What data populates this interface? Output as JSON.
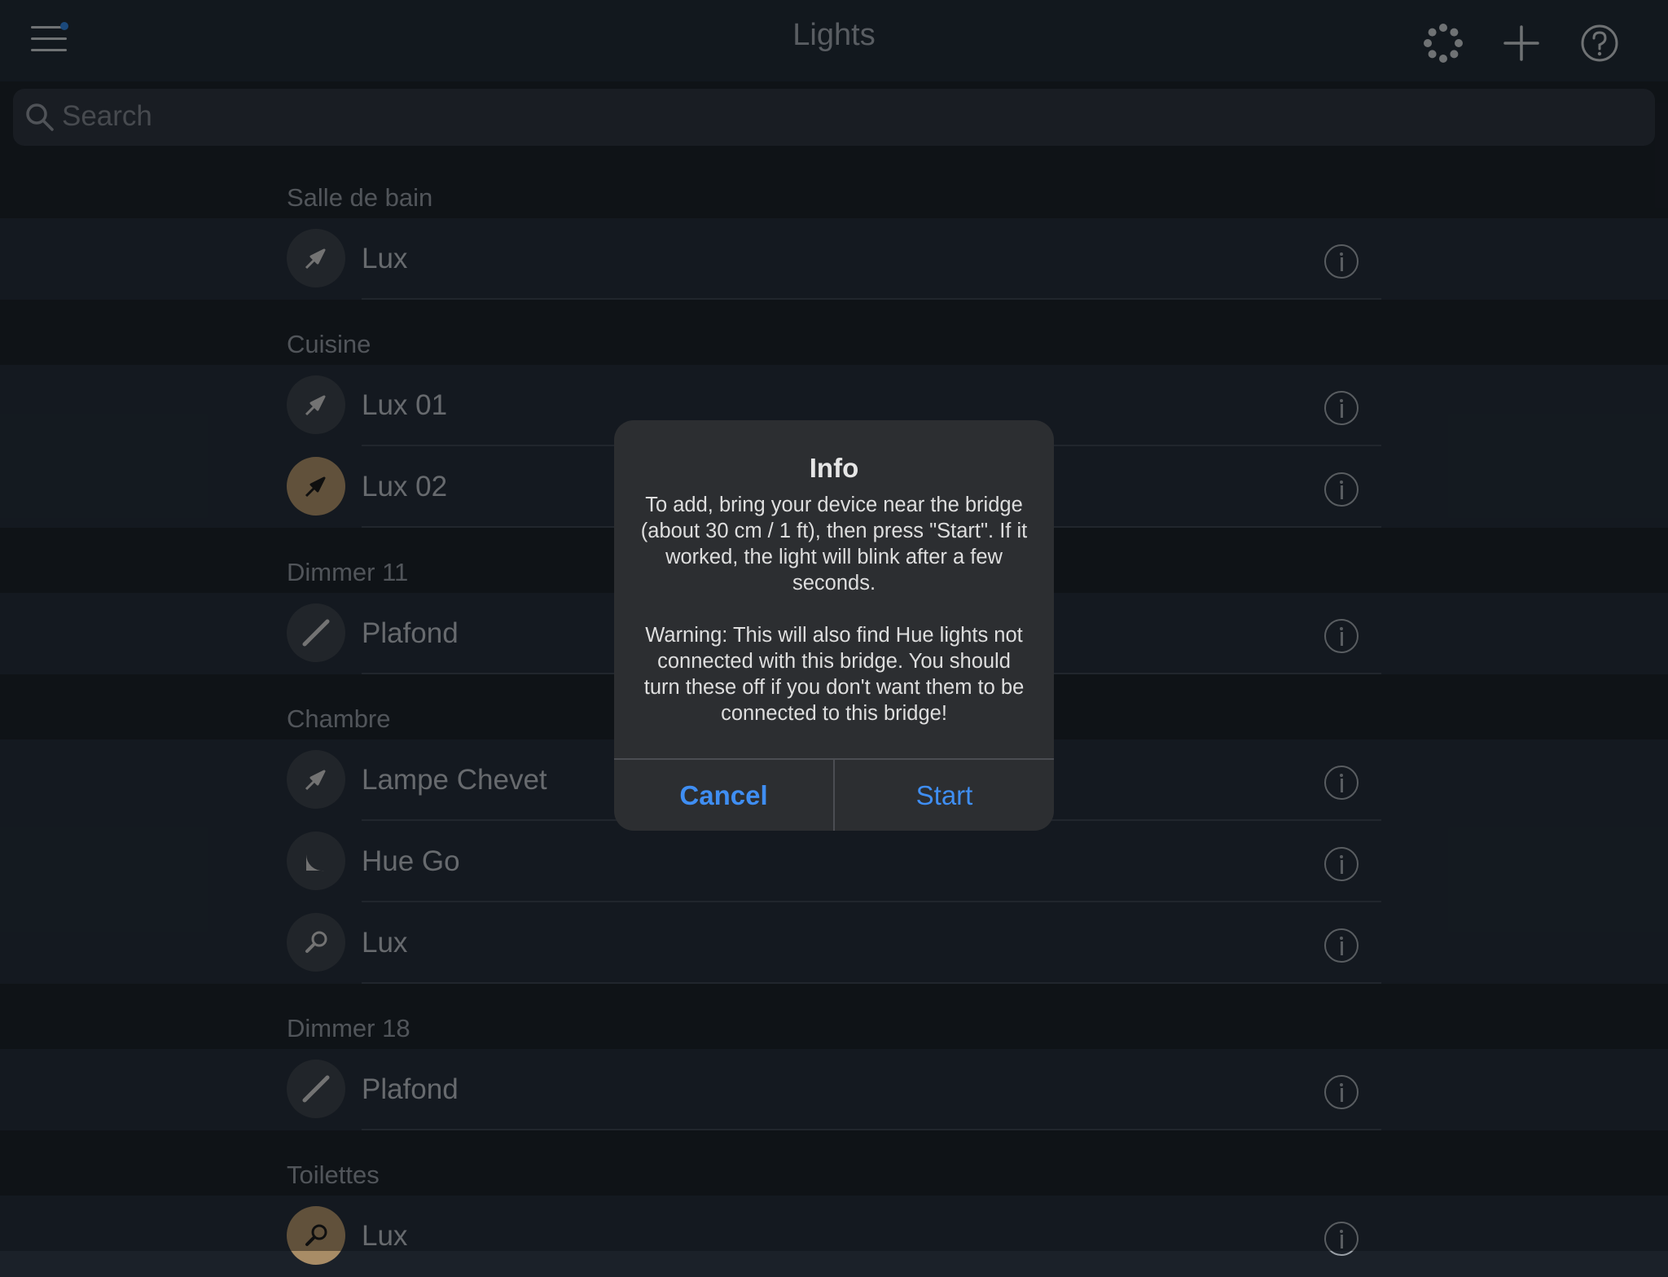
{
  "header": {
    "title": "Lights",
    "icons": [
      "menu-icon",
      "scenes-icon",
      "add-icon",
      "help-icon"
    ]
  },
  "search": {
    "placeholder": "Search"
  },
  "sections": [
    {
      "title": "Salle de bain",
      "lights": [
        {
          "name": "Lux",
          "icon": "bulb-icon",
          "on": false
        }
      ]
    },
    {
      "title": "Cuisine",
      "lights": [
        {
          "name": "Lux 01",
          "icon": "bulb-icon",
          "on": false
        },
        {
          "name": "Lux 02",
          "icon": "bulb-icon",
          "on": true
        }
      ]
    },
    {
      "title": "Dimmer 11",
      "lights": [
        {
          "name": "Plafond",
          "icon": "lightstrip-icon",
          "on": false
        }
      ]
    },
    {
      "title": "Chambre",
      "lights": [
        {
          "name": "Lampe Chevet",
          "icon": "bulb-icon",
          "on": false
        },
        {
          "name": "Hue Go",
          "icon": "hue-go-icon",
          "on": false
        },
        {
          "name": "Lux",
          "icon": "spot-icon",
          "on": false
        }
      ]
    },
    {
      "title": "Dimmer 18",
      "lights": [
        {
          "name": "Plafond",
          "icon": "lightstrip-icon",
          "on": false
        }
      ]
    },
    {
      "title": "Toilettes",
      "lights": [
        {
          "name": "Lux",
          "icon": "spot-icon",
          "on": true
        }
      ]
    }
  ],
  "dialog": {
    "title": "Info",
    "message_1": "To add, bring your device near the bridge (about 30 cm / 1 ft), then press \"Start\". If it worked, the light will blink after a few seconds.",
    "message_2": "Warning: This will also find Hue lights not connected with this bridge. You should turn these off if you don't want them to be connected to this bridge!",
    "cancel_label": "Cancel",
    "start_label": "Start",
    "button_color": "#3f8ef3"
  },
  "colors": {
    "background": "#1b2129",
    "row": "#232c37",
    "bulb_on": "#a88c66",
    "bulb_off": "#3a4049"
  }
}
